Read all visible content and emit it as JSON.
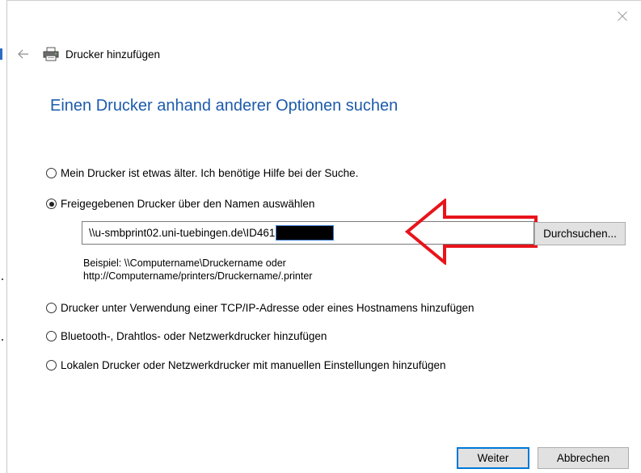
{
  "window": {
    "title": "Drucker hinzufügen",
    "heading": "Einen Drucker anhand anderer Optionen suchen"
  },
  "options": [
    {
      "label": "Mein Drucker ist etwas älter. Ich benötige Hilfe bei der Suche.",
      "checked": false
    },
    {
      "label": "Freigegebenen Drucker über den Namen auswählen",
      "checked": true
    },
    {
      "label": "Drucker unter Verwendung einer TCP/IP-Adresse oder eines Hostnamens hinzufügen",
      "checked": false
    },
    {
      "label": "Bluetooth-, Drahtlos- oder Netzwerkdrucker hinzufügen",
      "checked": false
    },
    {
      "label": "Lokalen Drucker oder Netzwerkdrucker mit manuellen Einstellungen hinzufügen",
      "checked": false
    }
  ],
  "shared_printer": {
    "path_value": "\\\\u-smbprint02.uni-tuebingen.de\\ID461",
    "browse_label": "Durchsuchen...",
    "example_line1": "Beispiel: \\\\Computername\\Druckername oder",
    "example_line2": "http://Computername/printers/Druckername/.printer"
  },
  "footer": {
    "next_label": "Weiter",
    "cancel_label": "Abbrechen"
  },
  "colors": {
    "heading": "#1d5bab",
    "primary_border": "#0078d7",
    "annotation_arrow": "#e8141b"
  },
  "icons": {
    "back": "back-arrow-icon",
    "close": "close-icon",
    "printer": "printer-icon"
  }
}
